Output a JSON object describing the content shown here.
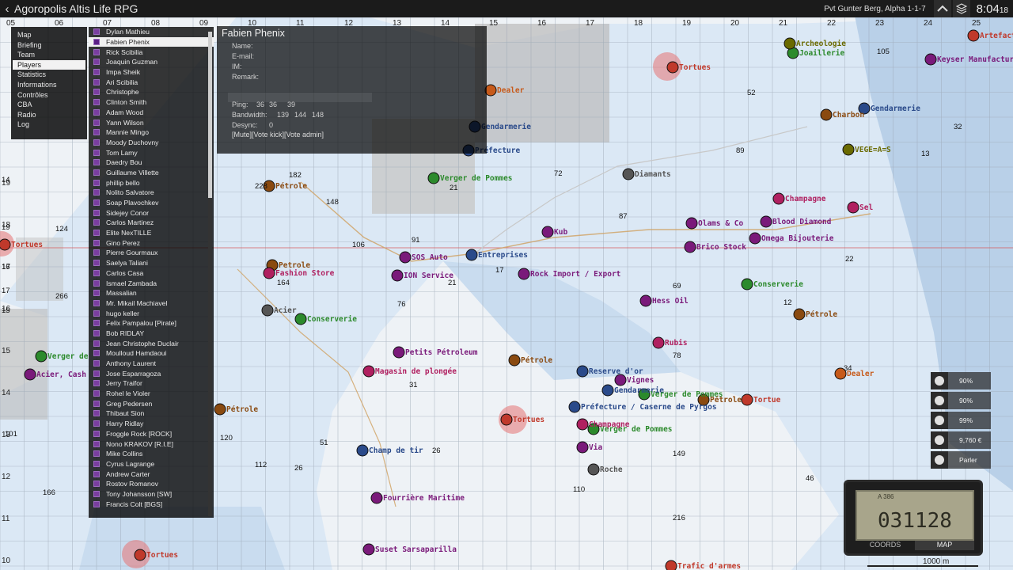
{
  "window": {
    "title": "Agoropolis Altis Life RPG",
    "player": "Pvt Gunter Berg, Alpha 1-1-7",
    "clock": "8:04",
    "clock_sec": "18"
  },
  "menu": [
    "Map",
    "Briefing",
    "Team",
    "Players",
    "Statistics",
    "Informations",
    "Contrôles",
    "CBA",
    "Radio",
    "Log"
  ],
  "menu_selected_index": 3,
  "players": [
    "Dylan Mathieu",
    "Fabien Phenix",
    "Rick Scibilia",
    "Joaquin Guzman",
    "Impa Sheik",
    "Ari Scibilia",
    "Christophe",
    "Clinton Smith",
    "Adam Wood",
    "Yann Wilson",
    "Mannie Mingo",
    "Moody Duchovny",
    "Tom Lamy",
    "Daedry Bou",
    "Guillaume Villette",
    "phillip bello",
    "Nolito Salvatore",
    "Soap Plavochkev",
    "Sidejey Conor",
    "Carlos Martinez",
    "Elite NexTILLE",
    "Gino Perez",
    "Pierre Gourmaux",
    "Saelya Taliani",
    "Carlos Casa",
    "Ismael Zambada",
    "Massalian",
    "Mr. Mikail Machiavel",
    "hugo keller",
    "Felix Pampalou [Pirate]",
    "Bob RIDLAY",
    "Jean Christophe Duclair",
    "Moulloud Hamdaoui",
    "Anthony Laurent",
    "Jose Esparragoza",
    "Jerry Traifor",
    "Rohel le Violer",
    "Greg Pedersen",
    "Thibaut Sion",
    "Harry Ridlay",
    "Froggle Rock [ROCK]",
    "Nono KRAKOV [R.I.E]",
    "Mike Collins",
    "Cyrus Lagrange",
    "Andrew Carter",
    "Rostov Romanov",
    "Tony Johansson [SW]",
    "Francis Colt [BGS]"
  ],
  "player_selected_index": 1,
  "detail": {
    "name": "Fabien Phenix",
    "fields": [
      "Name:",
      "E-mail:",
      "IM:",
      "Remark:"
    ],
    "ping_label": "Ping:",
    "ping": [
      "36",
      "36",
      "39"
    ],
    "bandwidth_label": "Bandwidth:",
    "bandwidth": [
      "139",
      "144",
      "148"
    ],
    "desync_label": "Desync:",
    "desync": [
      "0"
    ],
    "actions": "[Mute][Vote kick][Vote admin]"
  },
  "status": [
    {
      "icon": "food-icon",
      "value": "90%"
    },
    {
      "icon": "water-icon",
      "value": "90%"
    },
    {
      "icon": "health-icon",
      "value": "99%"
    },
    {
      "icon": "money-icon",
      "value": "9,760 €"
    },
    {
      "icon": "voice-icon",
      "value": "Parler"
    }
  ],
  "gps": {
    "top": "A 386",
    "digits": "031128",
    "tab_coords": "COORDS",
    "tab_map": "MAP"
  },
  "scale_label": "1000 m",
  "grid_top": [
    "05",
    "06",
    "07",
    "08",
    "09",
    "10",
    "11",
    "12",
    "13",
    "14",
    "15",
    "16",
    "17",
    "18",
    "19",
    "20",
    "21",
    "22",
    "23",
    "24",
    "25"
  ],
  "grid_left": [
    "19",
    "18",
    "17",
    "16",
    "15",
    "14",
    "13",
    "12",
    "11",
    "10"
  ],
  "map_labels": [
    {
      "t": "Tortues",
      "c": "#c0392b"
    },
    {
      "t": "Tortues",
      "c": "#c0392b"
    },
    {
      "t": "Tortues",
      "c": "#c0392b"
    },
    {
      "t": "Tortues",
      "c": "#c0392b"
    },
    {
      "t": "Dealer",
      "c": "#c75a1a"
    },
    {
      "t": "Gendarmerie",
      "c": "#2a4a8a"
    },
    {
      "t": "Préfecture",
      "c": "#2a4a8a"
    },
    {
      "t": "Verger de Pommes",
      "c": "#2c8a2c"
    },
    {
      "t": "Diamants",
      "c": "#555"
    },
    {
      "t": "Champagne",
      "c": "#b02060"
    },
    {
      "t": "Sel",
      "c": "#b02060"
    },
    {
      "t": "Joaillerie",
      "c": "#2c8a2c"
    },
    {
      "t": "Charbon",
      "c": "#8a4a10"
    },
    {
      "t": "Gendarmerie",
      "c": "#2a4a8a"
    },
    {
      "t": "VEGE=A=S",
      "c": "#6a6a00"
    },
    {
      "t": "Keyser Manufacture",
      "c": "#7a1a7a"
    },
    {
      "t": "Archeologie",
      "c": "#6a6a00"
    },
    {
      "t": "Blood Diamond",
      "c": "#7a1a7a"
    },
    {
      "t": "Omega Bijouterie",
      "c": "#7a1a7a"
    },
    {
      "t": "Olams & Co",
      "c": "#7a1a7a"
    },
    {
      "t": "Brico Stock",
      "c": "#7a1a7a"
    },
    {
      "t": "Conserverie",
      "c": "#2c8a2c"
    },
    {
      "t": "Pétrole",
      "c": "#8a4a10"
    },
    {
      "t": "Hess Oil",
      "c": "#7a1a7a"
    },
    {
      "t": "Rock Import / Export",
      "c": "#7a1a7a"
    },
    {
      "t": "Kub",
      "c": "#7a1a7a"
    },
    {
      "t": "SOS Auto",
      "c": "#7a1a7a"
    },
    {
      "t": "ION Service",
      "c": "#7a1a7a"
    },
    {
      "t": "Entreprises",
      "c": "#2a4a8a"
    },
    {
      "t": "Pétrole",
      "c": "#8a4a10"
    },
    {
      "t": "Conserverie",
      "c": "#2c8a2c"
    },
    {
      "t": "Acier",
      "c": "#555"
    },
    {
      "t": "Petrole",
      "c": "#8a4a10"
    },
    {
      "t": "Fashion Store",
      "c": "#b02060"
    },
    {
      "t": "Petits Pétroleum",
      "c": "#7a1a7a"
    },
    {
      "t": "Magasin de plongée",
      "c": "#b02060"
    },
    {
      "t": "Pétrole",
      "c": "#8a4a10"
    },
    {
      "t": "Rubis",
      "c": "#b02060"
    },
    {
      "t": "Reserve d'or",
      "c": "#2a4a8a"
    },
    {
      "t": "Vignes",
      "c": "#7a1a7a"
    },
    {
      "t": "Gendarmerie",
      "c": "#2a4a8a"
    },
    {
      "t": "Verger de Pommes",
      "c": "#2c8a2c"
    },
    {
      "t": "Verger de Pommes",
      "c": "#2c8a2c"
    },
    {
      "t": "Dealer",
      "c": "#c75a1a"
    },
    {
      "t": "Pétrole",
      "c": "#8a4a10"
    },
    {
      "t": "Champ de tir",
      "c": "#2a4a8a"
    },
    {
      "t": "Fourrière Maritime",
      "c": "#7a1a7a"
    },
    {
      "t": "Suset Sarsaparilla",
      "c": "#7a1a7a"
    },
    {
      "t": "Trafic d'armes",
      "c": "#c0392b"
    },
    {
      "t": "Via",
      "c": "#7a1a7a"
    },
    {
      "t": "Roche",
      "c": "#555"
    },
    {
      "t": "Champagne",
      "c": "#b02060"
    },
    {
      "t": "Préfecture / Caserne de Pyrgos",
      "c": "#2a4a8a"
    },
    {
      "t": "Verger de",
      "c": "#2c8a2c"
    },
    {
      "t": "Pétrole",
      "c": "#8a4a10"
    },
    {
      "t": "Tortue",
      "c": "#c0392b"
    },
    {
      "t": "Acier, Cash",
      "c": "#7a1a7a"
    },
    {
      "t": "Artefact",
      "c": "#c0392b"
    }
  ],
  "map_numbers": [
    "105",
    "52",
    "32",
    "13",
    "89",
    "228",
    "182",
    "148",
    "106",
    "91",
    "72",
    "87",
    "21",
    "17",
    "69",
    "22",
    "12",
    "164",
    "76",
    "21",
    "78",
    "31",
    "51",
    "26",
    "120",
    "112",
    "26",
    "149",
    "46",
    "110",
    "216",
    "166",
    "101",
    "124",
    "266",
    "34",
    "14",
    "19",
    "15",
    "16",
    "17"
  ]
}
